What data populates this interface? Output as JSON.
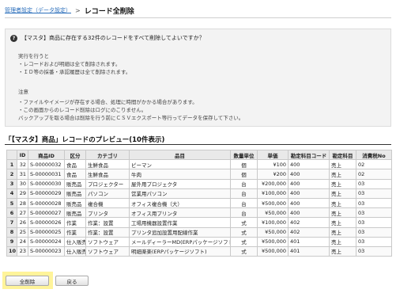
{
  "breadcrumb": {
    "parent": "管理者設定（データ設定）",
    "separator": ">",
    "current": "レコード全削除"
  },
  "notice": {
    "question": "【マスタ】商品に存在する32件のレコードをすべて削除してよいですか？",
    "lines": [
      "実行を行うと",
      "・レコードおよび明細は全て削除されます。",
      "・ＩＤ等の採番・承認履歴は全て削除されます。",
      "",
      "注意",
      "・ファイルやイメージが存在する場合、処理に時間がかかる場合があります。",
      "・この画面からのレコード削除はログにのこりません。",
      "バックアップを取る場合は削除を行う前にＣＳＶエクスポート等行ってデータを保存して下さい。"
    ]
  },
  "preview": {
    "title": "「【マスタ】商品」レコードのプレビュー(10件表示)",
    "columns": [
      "",
      "ID",
      "商品ID",
      "区分",
      "カテゴリ",
      "品目",
      "数量単位",
      "単価",
      "勘定科目コード",
      "勘定科目",
      "消費税No"
    ],
    "rows": [
      [
        "1",
        "32",
        "S-00000032",
        "食品",
        "生鮮食品",
        "ピーマン",
        "個",
        "¥100",
        "400",
        "売上",
        "02"
      ],
      [
        "2",
        "31",
        "S-00000031",
        "食品",
        "生鮮食品",
        "牛肉",
        "個",
        "¥200",
        "400",
        "売上",
        "02"
      ],
      [
        "3",
        "30",
        "S-00000030",
        "販売品",
        "プロジェクター",
        "屋外用プロジェクタ",
        "台",
        "¥200,000",
        "400",
        "売上",
        "03"
      ],
      [
        "4",
        "29",
        "S-00000029",
        "販売品",
        "パソコン",
        "営業用パソコン",
        "台",
        "¥100,000",
        "400",
        "売上",
        "03"
      ],
      [
        "5",
        "28",
        "S-00000028",
        "販売品",
        "複合機",
        "オフィス複合機（大）",
        "台",
        "¥500,000",
        "400",
        "売上",
        "03"
      ],
      [
        "6",
        "27",
        "S-00000027",
        "販売品",
        "プリンタ",
        "オフィス用プリンタ",
        "台",
        "¥50,000",
        "400",
        "売上",
        "03"
      ],
      [
        "7",
        "26",
        "S-00000026",
        "作業",
        "作業：設置",
        "工場用機器設置作業",
        "式",
        "¥100,000",
        "402",
        "売上",
        "03"
      ],
      [
        "8",
        "25",
        "S-00000025",
        "作業",
        "作業：設置",
        "プリンタ追加設置用配線作業",
        "式",
        "¥50,000",
        "402",
        "売上",
        "03"
      ],
      [
        "9",
        "24",
        "S-00000024",
        "仕入販売",
        "ソフトウェア",
        "メールディーラーMD(ERPパッケージソフト)",
        "式",
        "¥500,000",
        "401",
        "売上",
        "03"
      ],
      [
        "10",
        "23",
        "S-00000023",
        "仕入販売",
        "ソフトウェア",
        "明細楽楽(ERPパッケージソフト)",
        "式",
        "¥500,000",
        "401",
        "売上",
        "03"
      ]
    ]
  },
  "buttons": {
    "delete": "全削除",
    "back": "戻る"
  },
  "colors": {
    "link": "#2a6ebb",
    "highlight": "#fff49a",
    "notice_bg": "#f3f3f3"
  }
}
